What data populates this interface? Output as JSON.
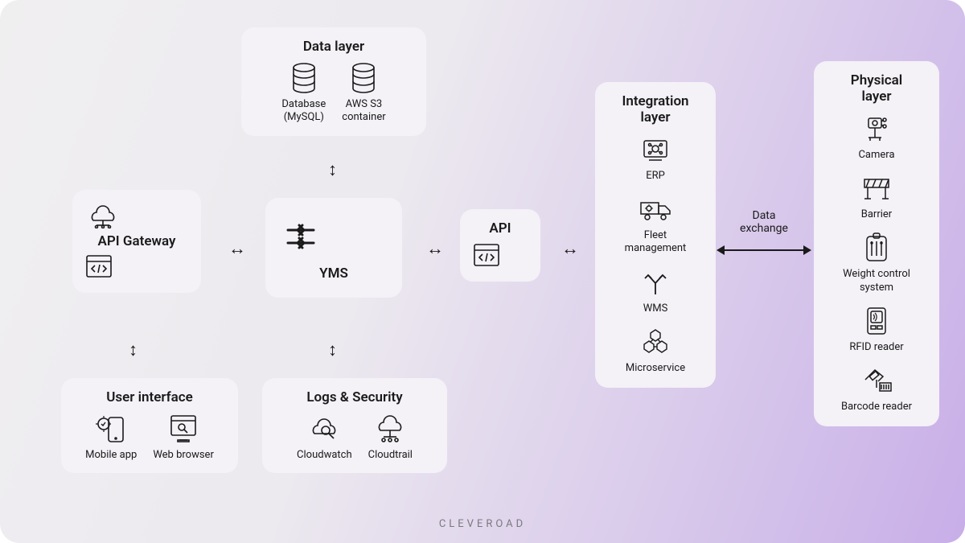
{
  "data_layer": {
    "title": "Data layer",
    "items": [
      {
        "label": "Database\n(MySQL)",
        "icon": "database-icon"
      },
      {
        "label": "AWS S3\ncontainer",
        "icon": "database-icon"
      }
    ]
  },
  "api_gateway": {
    "title": "API Gateway",
    "icon": "cloud-api-icon",
    "box_icon": "code-window-icon"
  },
  "yms": {
    "title": "YMS",
    "icon": "cycle-arrows-icon"
  },
  "api": {
    "title": "API",
    "icon": "code-window-icon"
  },
  "user_interface": {
    "title": "User interface",
    "items": [
      {
        "label": "Mobile app",
        "icon": "mobile-app-icon"
      },
      {
        "label": "Web browser",
        "icon": "web-browser-icon"
      }
    ]
  },
  "logs_security": {
    "title": "Logs & Security",
    "items": [
      {
        "label": "Cloudwatch",
        "icon": "cloudwatch-icon"
      },
      {
        "label": "Cloudtrail",
        "icon": "cloudtrail-icon"
      }
    ]
  },
  "integration_layer": {
    "title": "Integration\nlayer",
    "items": [
      {
        "label": "ERP",
        "icon": "erp-icon"
      },
      {
        "label": "Fleet\nmanagement",
        "icon": "truck-icon"
      },
      {
        "label": "WMS",
        "icon": "split-arrow-icon"
      },
      {
        "label": "Microservice",
        "icon": "microservice-icon"
      }
    ]
  },
  "physical_layer": {
    "title": "Physical\nlayer",
    "items": [
      {
        "label": "Camera",
        "icon": "camera-icon"
      },
      {
        "label": "Barrier",
        "icon": "barrier-icon"
      },
      {
        "label": "Weight control\nsystem",
        "icon": "weight-icon"
      },
      {
        "label": "RFID reader",
        "icon": "rfid-icon"
      },
      {
        "label": "Barcode reader",
        "icon": "barcode-icon"
      }
    ]
  },
  "exchange_label": "Data\nexchange",
  "footer": "CLEVEROAD"
}
